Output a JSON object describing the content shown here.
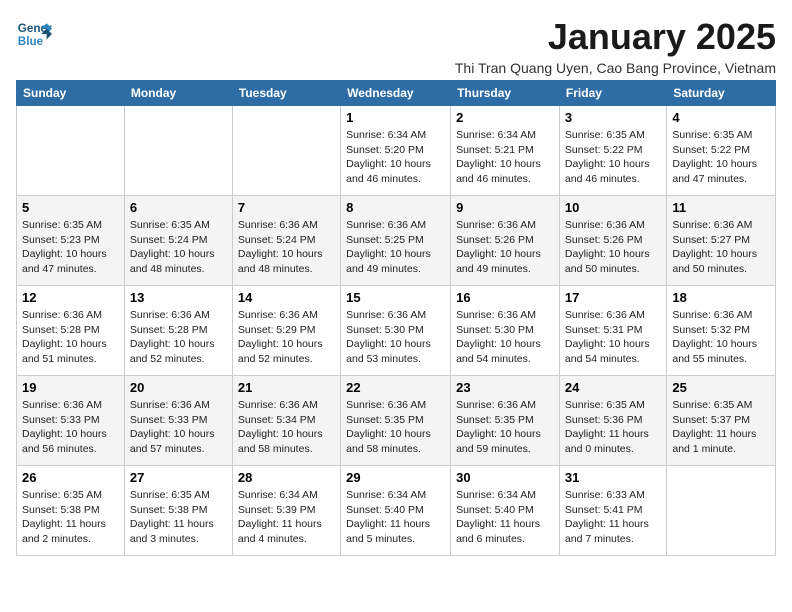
{
  "logo": {
    "line1": "General",
    "line2": "Blue"
  },
  "title": "January 2025",
  "subtitle": "Thi Tran Quang Uyen, Cao Bang Province, Vietnam",
  "weekdays": [
    "Sunday",
    "Monday",
    "Tuesday",
    "Wednesday",
    "Thursday",
    "Friday",
    "Saturday"
  ],
  "weeks": [
    [
      {
        "day": "",
        "info": ""
      },
      {
        "day": "",
        "info": ""
      },
      {
        "day": "",
        "info": ""
      },
      {
        "day": "1",
        "info": "Sunrise: 6:34 AM\nSunset: 5:20 PM\nDaylight: 10 hours and 46 minutes."
      },
      {
        "day": "2",
        "info": "Sunrise: 6:34 AM\nSunset: 5:21 PM\nDaylight: 10 hours and 46 minutes."
      },
      {
        "day": "3",
        "info": "Sunrise: 6:35 AM\nSunset: 5:22 PM\nDaylight: 10 hours and 46 minutes."
      },
      {
        "day": "4",
        "info": "Sunrise: 6:35 AM\nSunset: 5:22 PM\nDaylight: 10 hours and 47 minutes."
      }
    ],
    [
      {
        "day": "5",
        "info": "Sunrise: 6:35 AM\nSunset: 5:23 PM\nDaylight: 10 hours and 47 minutes."
      },
      {
        "day": "6",
        "info": "Sunrise: 6:35 AM\nSunset: 5:24 PM\nDaylight: 10 hours and 48 minutes."
      },
      {
        "day": "7",
        "info": "Sunrise: 6:36 AM\nSunset: 5:24 PM\nDaylight: 10 hours and 48 minutes."
      },
      {
        "day": "8",
        "info": "Sunrise: 6:36 AM\nSunset: 5:25 PM\nDaylight: 10 hours and 49 minutes."
      },
      {
        "day": "9",
        "info": "Sunrise: 6:36 AM\nSunset: 5:26 PM\nDaylight: 10 hours and 49 minutes."
      },
      {
        "day": "10",
        "info": "Sunrise: 6:36 AM\nSunset: 5:26 PM\nDaylight: 10 hours and 50 minutes."
      },
      {
        "day": "11",
        "info": "Sunrise: 6:36 AM\nSunset: 5:27 PM\nDaylight: 10 hours and 50 minutes."
      }
    ],
    [
      {
        "day": "12",
        "info": "Sunrise: 6:36 AM\nSunset: 5:28 PM\nDaylight: 10 hours and 51 minutes."
      },
      {
        "day": "13",
        "info": "Sunrise: 6:36 AM\nSunset: 5:28 PM\nDaylight: 10 hours and 52 minutes."
      },
      {
        "day": "14",
        "info": "Sunrise: 6:36 AM\nSunset: 5:29 PM\nDaylight: 10 hours and 52 minutes."
      },
      {
        "day": "15",
        "info": "Sunrise: 6:36 AM\nSunset: 5:30 PM\nDaylight: 10 hours and 53 minutes."
      },
      {
        "day": "16",
        "info": "Sunrise: 6:36 AM\nSunset: 5:30 PM\nDaylight: 10 hours and 54 minutes."
      },
      {
        "day": "17",
        "info": "Sunrise: 6:36 AM\nSunset: 5:31 PM\nDaylight: 10 hours and 54 minutes."
      },
      {
        "day": "18",
        "info": "Sunrise: 6:36 AM\nSunset: 5:32 PM\nDaylight: 10 hours and 55 minutes."
      }
    ],
    [
      {
        "day": "19",
        "info": "Sunrise: 6:36 AM\nSunset: 5:33 PM\nDaylight: 10 hours and 56 minutes."
      },
      {
        "day": "20",
        "info": "Sunrise: 6:36 AM\nSunset: 5:33 PM\nDaylight: 10 hours and 57 minutes."
      },
      {
        "day": "21",
        "info": "Sunrise: 6:36 AM\nSunset: 5:34 PM\nDaylight: 10 hours and 58 minutes."
      },
      {
        "day": "22",
        "info": "Sunrise: 6:36 AM\nSunset: 5:35 PM\nDaylight: 10 hours and 58 minutes."
      },
      {
        "day": "23",
        "info": "Sunrise: 6:36 AM\nSunset: 5:35 PM\nDaylight: 10 hours and 59 minutes."
      },
      {
        "day": "24",
        "info": "Sunrise: 6:35 AM\nSunset: 5:36 PM\nDaylight: 11 hours and 0 minutes."
      },
      {
        "day": "25",
        "info": "Sunrise: 6:35 AM\nSunset: 5:37 PM\nDaylight: 11 hours and 1 minute."
      }
    ],
    [
      {
        "day": "26",
        "info": "Sunrise: 6:35 AM\nSunset: 5:38 PM\nDaylight: 11 hours and 2 minutes."
      },
      {
        "day": "27",
        "info": "Sunrise: 6:35 AM\nSunset: 5:38 PM\nDaylight: 11 hours and 3 minutes."
      },
      {
        "day": "28",
        "info": "Sunrise: 6:34 AM\nSunset: 5:39 PM\nDaylight: 11 hours and 4 minutes."
      },
      {
        "day": "29",
        "info": "Sunrise: 6:34 AM\nSunset: 5:40 PM\nDaylight: 11 hours and 5 minutes."
      },
      {
        "day": "30",
        "info": "Sunrise: 6:34 AM\nSunset: 5:40 PM\nDaylight: 11 hours and 6 minutes."
      },
      {
        "day": "31",
        "info": "Sunrise: 6:33 AM\nSunset: 5:41 PM\nDaylight: 11 hours and 7 minutes."
      },
      {
        "day": "",
        "info": ""
      }
    ]
  ]
}
